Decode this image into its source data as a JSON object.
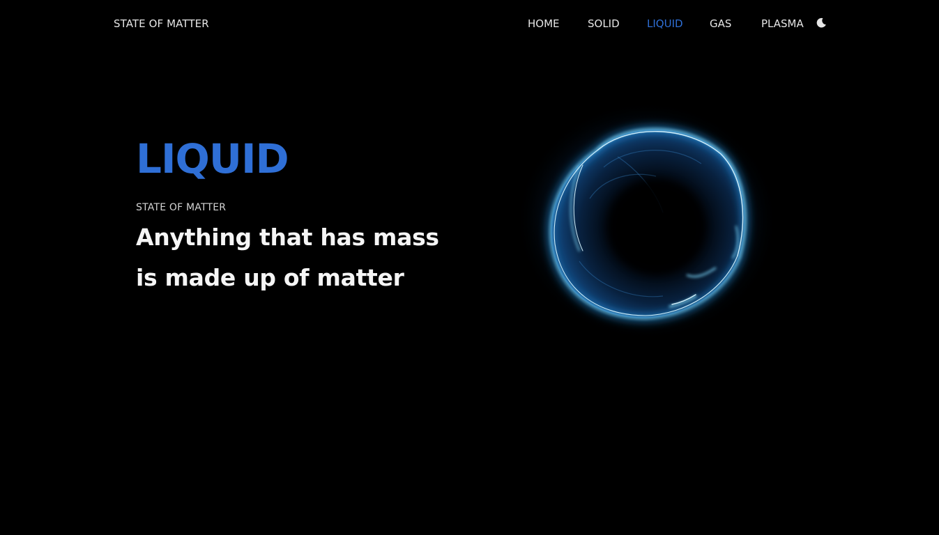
{
  "header": {
    "brand": "STATE OF MATTER",
    "nav": [
      {
        "label": "HOME"
      },
      {
        "label": "SOLID"
      },
      {
        "label": "LIQUID"
      },
      {
        "label": "GAS"
      },
      {
        "label": "PLASMA"
      }
    ],
    "active_nav": "LIQUID",
    "theme_toggle_icon": "moon-icon"
  },
  "hero": {
    "title": "LIQUID",
    "subtitle": "STATE OF MATTER",
    "description_line1": "Anything that has mass",
    "description_line2": "is made up of matter",
    "image_icon": "liquid-orb-image"
  },
  "colors": {
    "background": "#000000",
    "accent": "#2f6fd6",
    "nav_text": "#e6e6e6",
    "orb_glow": "#45c4ff"
  }
}
